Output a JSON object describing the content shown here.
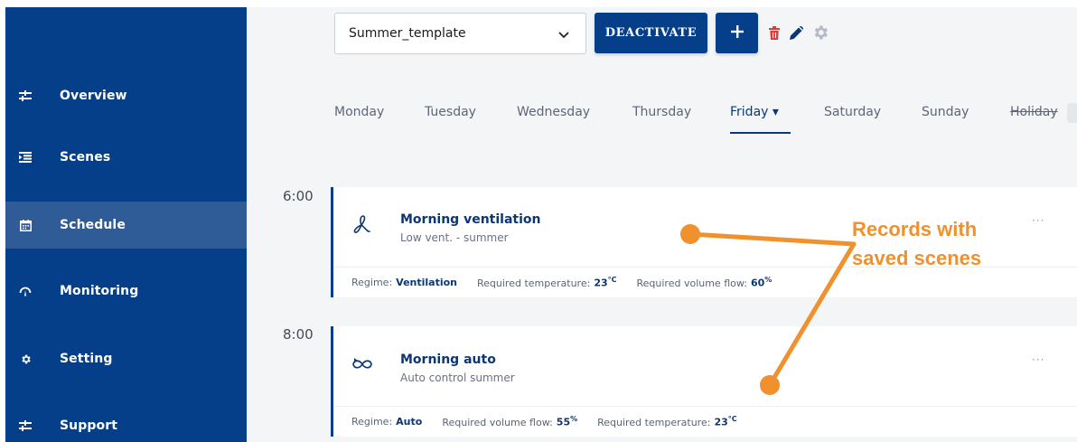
{
  "sidebar": {
    "items": [
      {
        "label": "Overview",
        "icon": "sliders-icon"
      },
      {
        "label": "Scenes",
        "icon": "list-indent-icon"
      },
      {
        "label": "Schedule",
        "icon": "calendar-icon",
        "active": true
      },
      {
        "label": "Monitoring",
        "icon": "gauge-icon"
      },
      {
        "label": "Setting",
        "icon": "gear-icon"
      },
      {
        "label": "Support",
        "icon": "sliders-icon"
      }
    ]
  },
  "toolbar": {
    "template_value": "Summer_template",
    "deactivate_label": "DEACTIVATE",
    "add_label": "+",
    "icons": [
      "trash-icon",
      "pencil-icon",
      "gear-icon"
    ]
  },
  "days": {
    "tabs": [
      "Monday",
      "Tuesday",
      "Wednesday",
      "Thursday",
      "Friday",
      "Saturday",
      "Sunday",
      "Holiday"
    ],
    "active": "Friday",
    "active_caret": "▾"
  },
  "records": [
    {
      "time": "6:00",
      "icon": "fan-icon",
      "title": "Morning ventilation",
      "subtitle": "Low vent. - summer",
      "more": "···",
      "params": [
        {
          "label": "Regime:",
          "value": "Ventilation",
          "unit": ""
        },
        {
          "label": "Required temperature:",
          "value": "23",
          "unit": "°C"
        },
        {
          "label": "Required volume flow:",
          "value": "60",
          "unit": "%"
        }
      ]
    },
    {
      "time": "8:00",
      "icon": "auto-icon",
      "title": "Morning auto",
      "subtitle": "Auto control summer",
      "more": "···",
      "params": [
        {
          "label": "Regime:",
          "value": "Auto",
          "unit": ""
        },
        {
          "label": "Required volume flow:",
          "value": "55",
          "unit": "%"
        },
        {
          "label": "Required temperature:",
          "value": "23",
          "unit": "°C"
        }
      ]
    }
  ],
  "annotation": {
    "line1": "Records with",
    "line2": "saved scenes",
    "color": "#f0912e"
  },
  "colors": {
    "sidebar": "#053f8a",
    "sidebar_active": "#2f5b96",
    "accent": "#0c3775",
    "delete": "#e53935",
    "annotation": "#f0912e"
  }
}
